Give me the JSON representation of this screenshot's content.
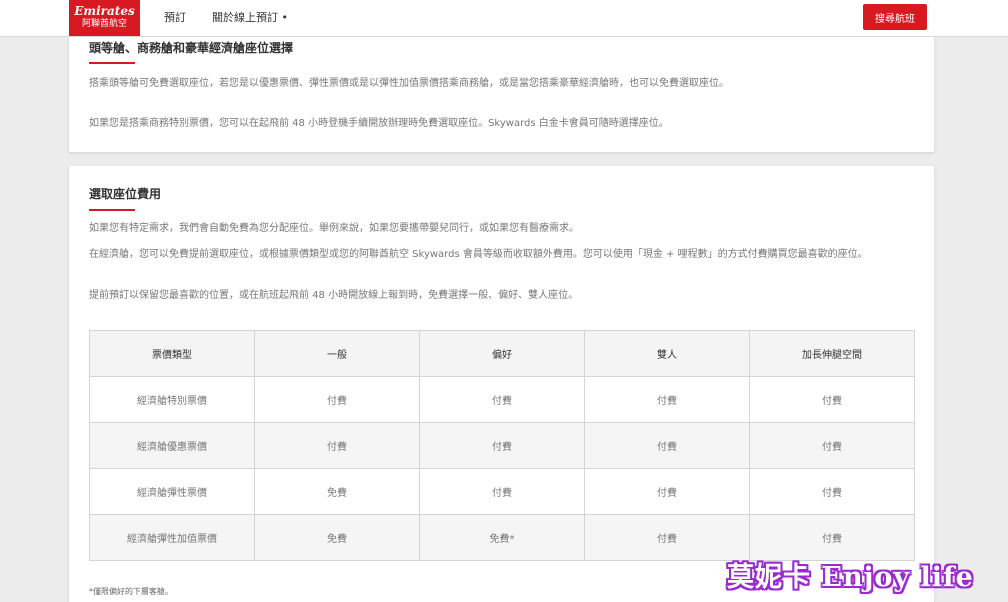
{
  "header": {
    "logo_en": "Emirates",
    "logo_zh": "阿聯酋航空",
    "nav": [
      "預訂",
      "關於線上預訂 •"
    ],
    "search_button": "搜尋航班"
  },
  "section1": {
    "title": "頭等艙、商務艙和豪華經濟艙座位選擇",
    "paragraphs": [
      "搭乘頭等艙可免費選取座位，若您是以優惠票價、彈性票價或是以彈性加值票價搭乘商務艙，或是當您搭乘豪華經濟艙時，也可以免費選取座位。",
      "如果您是搭乘商務特別票價，您可以在起飛前 48 小時登機手續開放辦理時免費選取座位。Skywards 白金卡會員可隨時選擇座位。"
    ]
  },
  "section2": {
    "title": "選取座位費用",
    "paragraphs": [
      "如果您有特定需求，我們會自動免費為您分配座位。舉例來說，如果您要攜帶嬰兒同行，或如果您有醫療需求。",
      "在經濟艙，您可以免費提前選取座位，或根據票價類型或您的阿聯酋航空 Skywards 會員等級而收取額外費用。您可以使用「現金 + 哩程數」的方式付費購買您最喜歡的座位。",
      "提前預訂以保留您最喜歡的位置，或在航班起飛前 48 小時開放線上報到時，免費選擇一般、偏好、雙人座位。"
    ],
    "table": {
      "headers": [
        "票價類型",
        "一般",
        "偏好",
        "雙人",
        "加長伸腿空間"
      ],
      "rows": [
        [
          "經濟艙特別票價",
          "付費",
          "付費",
          "付費",
          "付費"
        ],
        [
          "經濟艙優惠票價",
          "付費",
          "付費",
          "付費",
          "付費"
        ],
        [
          "經濟艙彈性票價",
          "免費",
          "付費",
          "付費",
          "付費"
        ],
        [
          "經濟艙彈性加值票價",
          "免費",
          "免費*",
          "付費",
          "付費"
        ]
      ]
    },
    "footnote": "*僅限偏好的下層客艙。"
  },
  "watermark": "莫妮卡 Enjoy life",
  "colors": {
    "brand_red": "#d71921",
    "watermark_outline": "#9a2ad0"
  }
}
